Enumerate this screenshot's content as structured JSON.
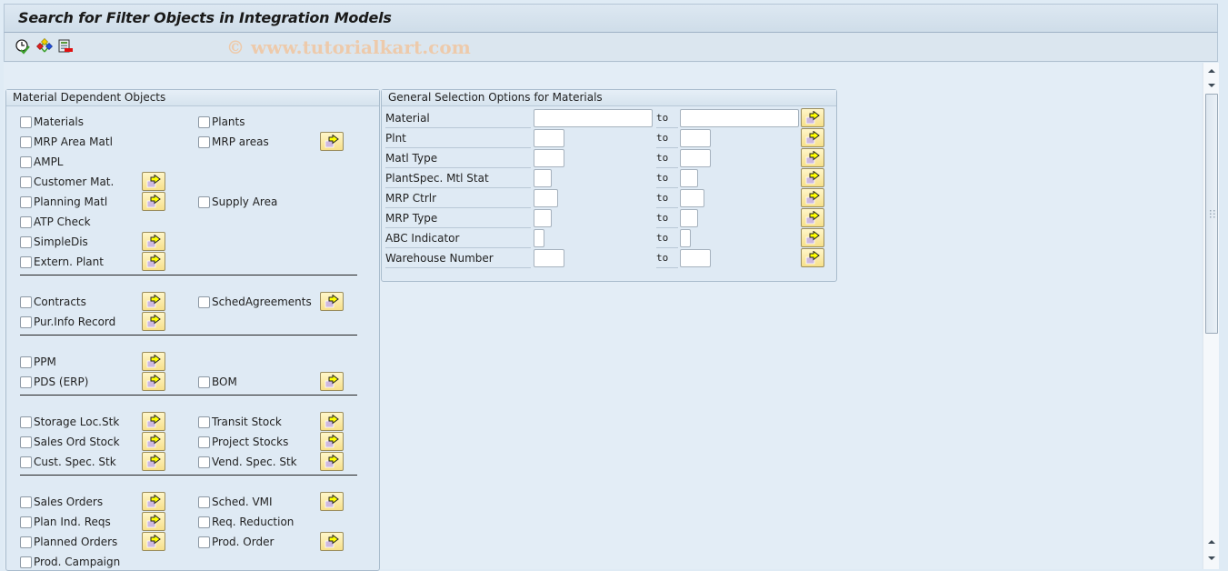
{
  "window": {
    "title": "Search for Filter Objects in Integration Models"
  },
  "toolbar": {
    "icons": [
      {
        "name": "execute-clock-icon",
        "tooltip": ""
      },
      {
        "name": "hierarchy-icon",
        "tooltip": ""
      },
      {
        "name": "layout-delete-icon",
        "tooltip": ""
      }
    ],
    "watermark": "© www.tutorialkart.com"
  },
  "material_dependent": {
    "title": "Material Dependent Objects",
    "items": [
      {
        "label": "Materials",
        "checked": false,
        "has_multi": false
      },
      {
        "label": "Plants",
        "checked": false,
        "has_multi": false
      },
      {
        "label": "MRP Area Matl",
        "checked": false,
        "has_multi": false
      },
      {
        "label": "MRP areas",
        "checked": false,
        "has_multi": true
      },
      {
        "label": "AMPL",
        "checked": false,
        "has_multi": false
      },
      {
        "label": "Customer Mat.",
        "checked": false,
        "has_multi": true
      },
      {
        "label": "Planning Matl",
        "checked": false,
        "has_multi": true
      },
      {
        "label": "Supply Area",
        "checked": false,
        "has_multi": false
      },
      {
        "label": "ATP Check",
        "checked": false,
        "has_multi": false
      },
      {
        "label": "SimpleDis",
        "checked": false,
        "has_multi": true
      },
      {
        "label": "Extern. Plant",
        "checked": false,
        "has_multi": true
      },
      {
        "label": "Contracts",
        "checked": false,
        "has_multi": true
      },
      {
        "label": "SchedAgreements",
        "checked": false,
        "has_multi": true
      },
      {
        "label": "Pur.Info Record",
        "checked": false,
        "has_multi": true
      },
      {
        "label": "PPM",
        "checked": false,
        "has_multi": true
      },
      {
        "label": "PDS (ERP)",
        "checked": false,
        "has_multi": true
      },
      {
        "label": "BOM",
        "checked": false,
        "has_multi": true
      },
      {
        "label": "Storage Loc.Stk",
        "checked": false,
        "has_multi": true
      },
      {
        "label": "Transit Stock",
        "checked": false,
        "has_multi": true
      },
      {
        "label": "Sales Ord Stock",
        "checked": false,
        "has_multi": true
      },
      {
        "label": "Project Stocks",
        "checked": false,
        "has_multi": true
      },
      {
        "label": "Cust. Spec. Stk",
        "checked": false,
        "has_multi": true
      },
      {
        "label": "Vend. Spec. Stk",
        "checked": false,
        "has_multi": true
      },
      {
        "label": "Sales Orders",
        "checked": false,
        "has_multi": true
      },
      {
        "label": "Sched. VMI",
        "checked": false,
        "has_multi": true
      },
      {
        "label": "Plan Ind. Reqs",
        "checked": false,
        "has_multi": true
      },
      {
        "label": "Req. Reduction",
        "checked": false,
        "has_multi": false
      },
      {
        "label": "Planned Orders",
        "checked": false,
        "has_multi": true
      },
      {
        "label": "Prod. Order",
        "checked": false,
        "has_multi": true
      },
      {
        "label": "Prod. Campaign",
        "checked": false,
        "has_multi": false
      }
    ]
  },
  "general_selection": {
    "title": "General Selection Options for Materials",
    "to_label": "to",
    "rows": [
      {
        "label": "Material",
        "from": "",
        "to": ""
      },
      {
        "label": "Plnt",
        "from": "",
        "to": ""
      },
      {
        "label": "Matl Type",
        "from": "",
        "to": ""
      },
      {
        "label": "PlantSpec. Mtl Stat",
        "from": "",
        "to": ""
      },
      {
        "label": "MRP Ctrlr",
        "from": "",
        "to": ""
      },
      {
        "label": "MRP Type",
        "from": "",
        "to": ""
      },
      {
        "label": "ABC Indicator",
        "from": "",
        "to": ""
      },
      {
        "label": "Warehouse Number",
        "from": "",
        "to": ""
      }
    ]
  },
  "colors": {
    "background": "#dfebf5",
    "multi_button": "#f7e08a",
    "arrow": "#ffff00"
  }
}
